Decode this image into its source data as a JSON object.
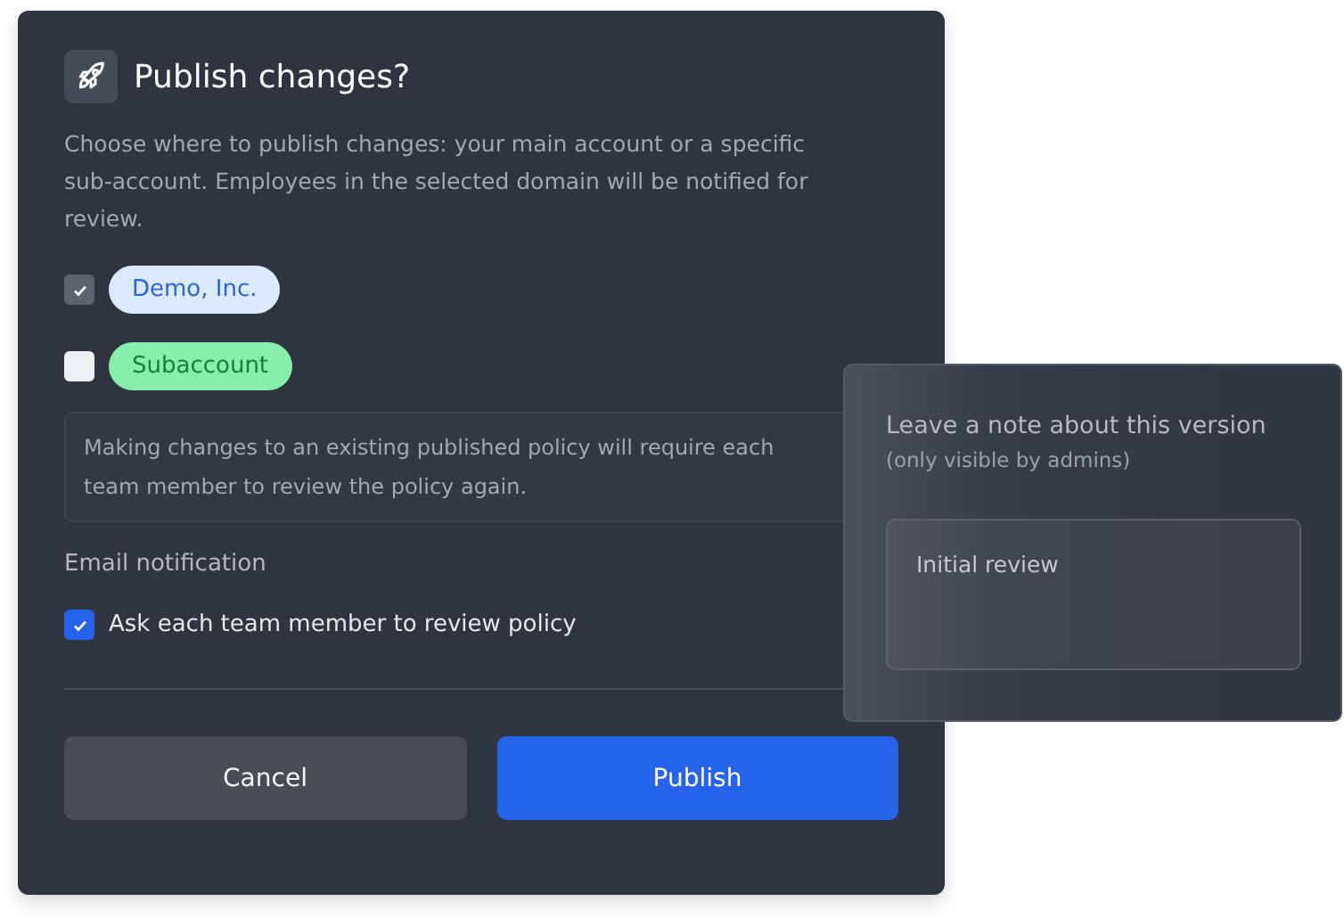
{
  "dialog": {
    "title": "Publish changes?",
    "description": "Choose where to publish changes: your main account or a specific sub-account. Employees in the selected domain will be notified for review.",
    "accounts": [
      {
        "label": "Demo, Inc.",
        "checked": true,
        "color": "#dbeafe"
      },
      {
        "label": "Subaccount",
        "checked": false,
        "color": "#86efac"
      }
    ],
    "notice": "Making changes to an existing published policy will require each team member to review the policy again.",
    "email_heading": "Email notification",
    "email_option": {
      "label": "Ask each team member to review policy",
      "checked": true
    },
    "buttons": [
      {
        "label": "Cancel",
        "kind": "secondary"
      },
      {
        "label": "Publish",
        "kind": "primary"
      }
    ]
  },
  "note_popover": {
    "title": "Leave a note about this version",
    "subtitle": "(only visible by admins)",
    "value": "Initial review"
  }
}
